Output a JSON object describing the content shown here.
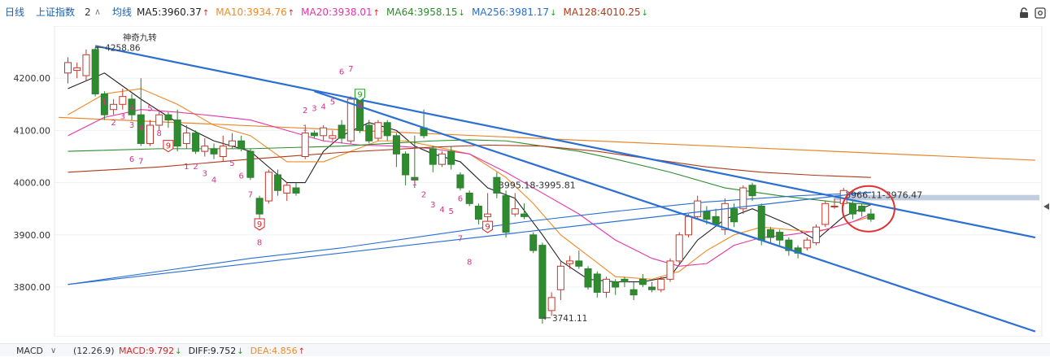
{
  "header": {
    "period": "日线",
    "index_name": "上证指数",
    "index_sub": "2",
    "ma_label": "均线",
    "ma_items": [
      {
        "label": "MA5:3960.37",
        "color": "#222222",
        "trend": "up"
      },
      {
        "label": "MA10:3934.76",
        "color": "#f08a24",
        "trend": "up"
      },
      {
        "label": "MA20:3938.01",
        "color": "#e535a8",
        "trend": "up"
      },
      {
        "label": "MA64:3958.15",
        "color": "#2e8b2e",
        "trend": "down"
      },
      {
        "label": "MA256:3981.17",
        "color": "#2a6fd1",
        "trend": "down"
      },
      {
        "label": "MA128:4010.25",
        "color": "#b03a1a",
        "trend": "down"
      }
    ],
    "up_color": "#e02020",
    "down_color": "#20a020"
  },
  "footer": {
    "indicator": "MACD",
    "params": "(12.26.9)",
    "items": [
      {
        "label": "MACD:9.792",
        "color": "#e02020",
        "trend": "down"
      },
      {
        "label": "DIFF:9.752",
        "color": "#222222",
        "trend": "down"
      },
      {
        "label": "DEA:4.856",
        "color": "#f08a24",
        "trend": "up"
      }
    ]
  },
  "chart_data": {
    "type": "candlestick",
    "ylim": [
      3705,
      4300
    ],
    "yticks": [
      {
        "value": 4200,
        "label": "4200.00"
      },
      {
        "value": 4100,
        "label": "4100.00"
      },
      {
        "value": 4000,
        "label": "4000.00"
      },
      {
        "value": 3900,
        "label": "3900.00"
      },
      {
        "value": 3800,
        "label": "3800.00"
      }
    ],
    "candles": [
      [
        4210,
        4230,
        4240,
        4190
      ],
      [
        4215,
        4220,
        4230,
        4200
      ],
      [
        4205,
        4245,
        4255,
        4195
      ],
      [
        4255,
        4170,
        4260,
        4165
      ],
      [
        4170,
        4130,
        4175,
        4120
      ],
      [
        4140,
        4150,
        4160,
        4130
      ],
      [
        4150,
        4165,
        4180,
        4140
      ],
      [
        4160,
        4130,
        4170,
        4120
      ],
      [
        4130,
        4075,
        4200,
        4070
      ],
      [
        4075,
        4110,
        4120,
        4070
      ],
      [
        4110,
        4130,
        4140,
        4100
      ],
      [
        4130,
        4120,
        4135,
        4105
      ],
      [
        4120,
        4070,
        4140,
        4060
      ],
      [
        4075,
        4095,
        4110,
        4065
      ],
      [
        4095,
        4060,
        4100,
        4055
      ],
      [
        4060,
        4070,
        4085,
        4050
      ],
      [
        4065,
        4055,
        4075,
        4045
      ],
      [
        4050,
        4070,
        4090,
        4040
      ],
      [
        4070,
        4080,
        4095,
        4065
      ],
      [
        4080,
        4065,
        4090,
        4060
      ],
      [
        4060,
        4010,
        4065,
        4005
      ],
      [
        3970,
        3940,
        3975,
        3925
      ],
      [
        3965,
        4020,
        4025,
        3960
      ],
      [
        4015,
        3985,
        4025,
        3975
      ],
      [
        3980,
        3995,
        4000,
        3965
      ],
      [
        3990,
        3980,
        4000,
        3975
      ],
      [
        4050,
        4095,
        4100,
        4045
      ],
      [
        4095,
        4090,
        4100,
        4085
      ],
      [
        4090,
        4105,
        4110,
        4080
      ],
      [
        4085,
        4090,
        4100,
        4080
      ],
      [
        4110,
        4085,
        4120,
        4075
      ],
      [
        4080,
        4160,
        4165,
        4075
      ],
      [
        4160,
        4100,
        4165,
        4095
      ],
      [
        4110,
        4080,
        4120,
        4075
      ],
      [
        4085,
        4115,
        4120,
        4080
      ],
      [
        4115,
        4090,
        4120,
        4080
      ],
      [
        4090,
        4055,
        4095,
        4030
      ],
      [
        4055,
        4015,
        4060,
        3995
      ],
      [
        4010,
        4005,
        4090,
        3990
      ],
      [
        4105,
        4090,
        4140,
        4085
      ],
      [
        4065,
        4035,
        4070,
        4020
      ],
      [
        4035,
        4055,
        4060,
        4030
      ],
      [
        4060,
        4035,
        4070,
        4025
      ],
      [
        4015,
        3990,
        4020,
        3985
      ],
      [
        3980,
        3960,
        3985,
        3955
      ],
      [
        3955,
        3930,
        3960,
        3920
      ],
      [
        3935,
        3940,
        3980,
        3925
      ],
      [
        4010,
        3980,
        4020,
        3970
      ],
      [
        3975,
        3905,
        3985,
        3895
      ],
      [
        3940,
        3950,
        3980,
        3935
      ],
      [
        3940,
        3935,
        3960,
        3930
      ],
      [
        3900,
        3870,
        3905,
        3865
      ],
      [
        3880,
        3740,
        3885,
        3730
      ],
      [
        3755,
        3780,
        3790,
        3745
      ],
      [
        3795,
        3840,
        3850,
        3775
      ],
      [
        3845,
        3850,
        3860,
        3835
      ],
      [
        3850,
        3840,
        3870,
        3835
      ],
      [
        3835,
        3800,
        3840,
        3795
      ],
      [
        3825,
        3790,
        3830,
        3780
      ],
      [
        3790,
        3815,
        3820,
        3780
      ],
      [
        3810,
        3800,
        3815,
        3785
      ],
      [
        3815,
        3810,
        3820,
        3800
      ],
      [
        3795,
        3785,
        3810,
        3775
      ],
      [
        3815,
        3805,
        3825,
        3800
      ],
      [
        3800,
        3795,
        3810,
        3790
      ],
      [
        3795,
        3815,
        3820,
        3790
      ],
      [
        3815,
        3850,
        3855,
        3810
      ],
      [
        3850,
        3900,
        3905,
        3845
      ],
      [
        3900,
        3935,
        3940,
        3895
      ],
      [
        3935,
        3965,
        3975,
        3930
      ],
      [
        3945,
        3930,
        3955,
        3920
      ],
      [
        3935,
        3920,
        3950,
        3915
      ],
      [
        3910,
        3960,
        3970,
        3900
      ],
      [
        3950,
        3925,
        3960,
        3915
      ],
      [
        3950,
        3990,
        3995,
        3940
      ],
      [
        3995,
        3975,
        4000,
        3965
      ],
      [
        3955,
        3890,
        3960,
        3880
      ],
      [
        3910,
        3895,
        3915,
        3885
      ],
      [
        3905,
        3890,
        3910,
        3880
      ],
      [
        3890,
        3870,
        3895,
        3860
      ],
      [
        3875,
        3865,
        3880,
        3855
      ],
      [
        3875,
        3890,
        3895,
        3870
      ],
      [
        3885,
        3915,
        3920,
        3880
      ],
      [
        3920,
        3960,
        3965,
        3915
      ],
      [
        3955,
        3955,
        3970,
        3950
      ],
      [
        3960,
        3985,
        3990,
        3955
      ],
      [
        3960,
        3940,
        3965,
        3930
      ],
      [
        3955,
        3945,
        3960,
        3935
      ],
      [
        3940,
        3930,
        3950,
        3925
      ]
    ],
    "ma_lines": [
      {
        "name": "MA5",
        "color": "#222222",
        "points": [
          [
            0,
            4180
          ],
          [
            4,
            4210
          ],
          [
            8,
            4160
          ],
          [
            12,
            4115
          ],
          [
            16,
            4080
          ],
          [
            20,
            4060
          ],
          [
            24,
            4000
          ],
          [
            26,
            4000
          ],
          [
            28,
            4060
          ],
          [
            30,
            4090
          ],
          [
            33,
            4115
          ],
          [
            36,
            4100
          ],
          [
            38,
            4070
          ],
          [
            40,
            4055
          ],
          [
            43,
            4040
          ],
          [
            46,
            3990
          ],
          [
            49,
            3970
          ],
          [
            52,
            3900
          ],
          [
            54,
            3850
          ],
          [
            57,
            3815
          ],
          [
            60,
            3810
          ],
          [
            63,
            3810
          ],
          [
            66,
            3820
          ],
          [
            69,
            3890
          ],
          [
            72,
            3930
          ],
          [
            75,
            3950
          ],
          [
            77,
            3935
          ],
          [
            79,
            3920
          ],
          [
            82,
            3890
          ],
          [
            85,
            3935
          ],
          [
            88,
            3958
          ]
        ]
      },
      {
        "name": "MA10",
        "color": "#f08a24",
        "points": [
          [
            0,
            4130
          ],
          [
            4,
            4170
          ],
          [
            8,
            4180
          ],
          [
            12,
            4150
          ],
          [
            16,
            4110
          ],
          [
            20,
            4090
          ],
          [
            24,
            4040
          ],
          [
            28,
            4040
          ],
          [
            31,
            4060
          ],
          [
            34,
            4080
          ],
          [
            37,
            4080
          ],
          [
            40,
            4070
          ],
          [
            44,
            4055
          ],
          [
            48,
            4010
          ],
          [
            51,
            3960
          ],
          [
            54,
            3900
          ],
          [
            57,
            3860
          ],
          [
            60,
            3820
          ],
          [
            64,
            3815
          ],
          [
            67,
            3830
          ],
          [
            70,
            3870
          ],
          [
            73,
            3900
          ],
          [
            76,
            3915
          ],
          [
            79,
            3910
          ],
          [
            82,
            3905
          ],
          [
            85,
            3920
          ],
          [
            88,
            3935
          ]
        ]
      },
      {
        "name": "MA20",
        "color": "#e535a8",
        "points": [
          [
            0,
            4090
          ],
          [
            4,
            4125
          ],
          [
            8,
            4140
          ],
          [
            12,
            4135
          ],
          [
            16,
            4128
          ],
          [
            20,
            4120
          ],
          [
            24,
            4100
          ],
          [
            28,
            4080
          ],
          [
            32,
            4072
          ],
          [
            36,
            4070
          ],
          [
            40,
            4065
          ],
          [
            44,
            4055
          ],
          [
            48,
            4020
          ],
          [
            52,
            3980
          ],
          [
            56,
            3940
          ],
          [
            60,
            3890
          ],
          [
            64,
            3855
          ],
          [
            67,
            3840
          ],
          [
            70,
            3845
          ],
          [
            73,
            3880
          ],
          [
            76,
            3895
          ],
          [
            79,
            3900
          ],
          [
            83,
            3910
          ],
          [
            86,
            3925
          ],
          [
            88,
            3940
          ]
        ]
      },
      {
        "name": "MA64",
        "color": "#2e8b2e",
        "points": [
          [
            0,
            4060
          ],
          [
            10,
            4065
          ],
          [
            20,
            4065
          ],
          [
            30,
            4070
          ],
          [
            40,
            4080
          ],
          [
            44,
            4082
          ],
          [
            48,
            4080
          ],
          [
            52,
            4070
          ],
          [
            56,
            4060
          ],
          [
            60,
            4045
          ],
          [
            66,
            4020
          ],
          [
            72,
            3990
          ],
          [
            78,
            3975
          ],
          [
            84,
            3963
          ],
          [
            88,
            3958
          ]
        ]
      },
      {
        "name": "MA128",
        "color": "#b03a1a",
        "points": [
          [
            0,
            4020
          ],
          [
            10,
            4030
          ],
          [
            20,
            4045
          ],
          [
            30,
            4058
          ],
          [
            40,
            4068
          ],
          [
            46,
            4072
          ],
          [
            52,
            4070
          ],
          [
            58,
            4060
          ],
          [
            64,
            4045
          ],
          [
            70,
            4030
          ],
          [
            76,
            4020
          ],
          [
            82,
            4014
          ],
          [
            88,
            4010
          ]
        ]
      },
      {
        "name": "MA256",
        "color": "#2a6fd1",
        "points": [
          [
            0,
            3805
          ],
          [
            10,
            3830
          ],
          [
            20,
            3855
          ],
          [
            30,
            3875
          ],
          [
            40,
            3900
          ],
          [
            50,
            3925
          ],
          [
            60,
            3945
          ],
          [
            70,
            3963
          ],
          [
            80,
            3975
          ],
          [
            88,
            3981
          ]
        ]
      }
    ],
    "long_line": {
      "color": "#e8872a",
      "points": [
        [
          -1,
          4125
        ],
        [
          106,
          4043
        ]
      ]
    },
    "trendlines": [
      {
        "color": "#2a6fd1",
        "points": [
          [
            3,
            4262
          ],
          [
            106,
            3895
          ]
        ]
      },
      {
        "color": "#2a6fd1",
        "points": [
          [
            27,
            4175
          ],
          [
            106,
            3715
          ]
        ]
      },
      {
        "color": "#2a6fd1",
        "points": [
          [
            0,
            3805
          ],
          [
            88,
            3982
          ]
        ]
      }
    ],
    "resistance_band": {
      "from": 3966.11,
      "to": 3976.47,
      "x_start": 84,
      "color": "#b9c8dc"
    },
    "annotations": [
      {
        "text": "4258.86",
        "x": 3,
        "y": 4258.86,
        "kind": "high"
      },
      {
        "text": "3741.11",
        "x": 52,
        "y": 3741.11,
        "kind": "low"
      },
      {
        "text": "3995.18-3995.81",
        "x": 47,
        "y": 3995.5,
        "kind": "range"
      },
      {
        "text": "3966.11-3976.47",
        "x": 85,
        "y": 3977,
        "kind": "range"
      },
      {
        "text": "神奇九转",
        "x": 6,
        "y": 4273,
        "kind": "label"
      }
    ],
    "td_seq": [
      {
        "x": 4,
        "y": 4150,
        "t": "1"
      },
      {
        "x": 5,
        "y": 4110,
        "t": "2"
      },
      {
        "x": 6,
        "y": 4122,
        "t": "3"
      },
      {
        "x": 7,
        "y": 4138,
        "t": "4"
      },
      {
        "x": 7,
        "y": 4105,
        "t": "3"
      },
      {
        "x": 8,
        "y": 4100,
        "t": "4"
      },
      {
        "x": 9,
        "y": 4137,
        "t": "5"
      },
      {
        "x": 10,
        "y": 4090,
        "t": "8"
      },
      {
        "x": 7,
        "y": 4040,
        "t": "6"
      },
      {
        "x": 8,
        "y": 4036,
        "t": "7"
      },
      {
        "x": 13,
        "y": 4026,
        "t": "1"
      },
      {
        "x": 14,
        "y": 4026,
        "t": "2"
      },
      {
        "x": 15,
        "y": 4013,
        "t": "3"
      },
      {
        "x": 16,
        "y": 4000,
        "t": "4"
      },
      {
        "x": 18,
        "y": 4032,
        "t": "5"
      },
      {
        "x": 19,
        "y": 4008,
        "t": "6"
      },
      {
        "x": 20,
        "y": 3972,
        "t": "7"
      },
      {
        "x": 21,
        "y": 3880,
        "t": "8"
      },
      {
        "x": 26,
        "y": 4100,
        "t": "1"
      },
      {
        "x": 26,
        "y": 4133,
        "t": "2"
      },
      {
        "x": 27,
        "y": 4137,
        "t": "3"
      },
      {
        "x": 28,
        "y": 4140,
        "t": "4"
      },
      {
        "x": 29,
        "y": 4150,
        "t": "5"
      },
      {
        "x": 30,
        "y": 4207,
        "t": "6"
      },
      {
        "x": 31,
        "y": 4213,
        "t": "7"
      },
      {
        "x": 32,
        "y": 4143,
        "t": "8"
      },
      {
        "x": 38,
        "y": 3995,
        "t": "1"
      },
      {
        "x": 39,
        "y": 3972,
        "t": "2"
      },
      {
        "x": 40,
        "y": 3953,
        "t": "3"
      },
      {
        "x": 41,
        "y": 3943,
        "t": "4"
      },
      {
        "x": 42,
        "y": 3940,
        "t": "5"
      },
      {
        "x": 43,
        "y": 3964,
        "t": "6"
      },
      {
        "x": 43,
        "y": 3888,
        "t": "7"
      },
      {
        "x": 44,
        "y": 3843,
        "t": "8"
      }
    ],
    "nine_marks": [
      {
        "x": 11,
        "y": 4070,
        "color": "#e02020"
      },
      {
        "x": 21,
        "y": 3920,
        "color": "#e02020"
      },
      {
        "x": 32,
        "y": 4168,
        "color": "#20a020"
      },
      {
        "x": 46,
        "y": 3915,
        "color": "#e02020"
      }
    ],
    "circle": {
      "x": 88,
      "y": 3950,
      "color": "#e03030"
    }
  }
}
